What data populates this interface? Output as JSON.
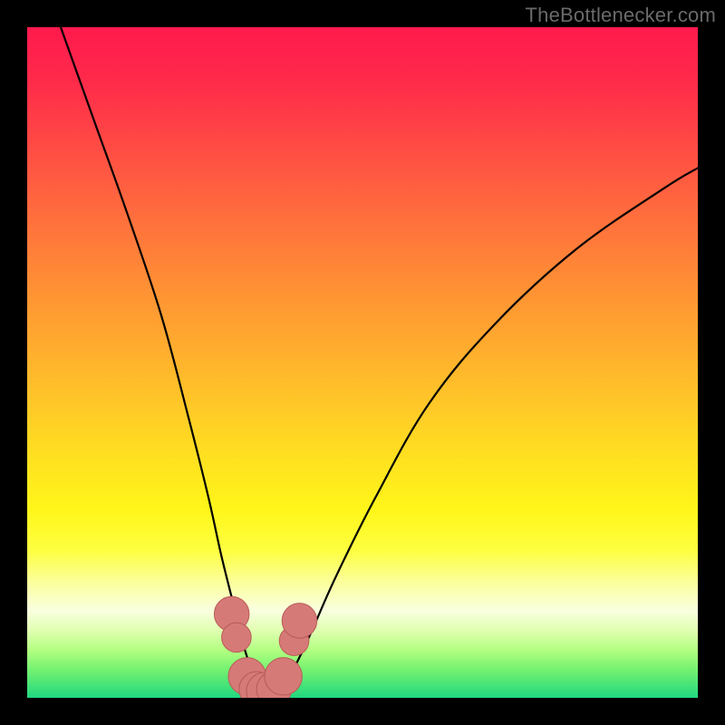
{
  "watermark": "TheBottlenecker.com",
  "colors": {
    "frame": "#000000",
    "gradient_top": "#ff1a4d",
    "gradient_bottom": "#20d880",
    "curve_stroke": "#000000",
    "marker_fill": "#d67a78",
    "marker_stroke": "#b85a56"
  },
  "chart_data": {
    "type": "line",
    "title": "",
    "xlabel": "",
    "ylabel": "",
    "xlim": [
      0,
      100
    ],
    "ylim": [
      0,
      100
    ],
    "series": [
      {
        "name": "curve",
        "x": [
          5,
          10,
          15,
          20,
          24,
          27,
          29,
          31,
          32.5,
          34,
          35.5,
          37,
          39,
          42,
          46,
          52,
          60,
          70,
          82,
          95,
          100
        ],
        "y": [
          100,
          86,
          72,
          57,
          42,
          30,
          21,
          13,
          7,
          3,
          1,
          1,
          3,
          9,
          18,
          30,
          44,
          56,
          67,
          76,
          79
        ]
      }
    ],
    "markers": {
      "name": "highlight-points",
      "x": [
        30.5,
        31.2,
        32.8,
        34.2,
        35.5,
        36.8,
        38.2,
        39.8,
        40.6
      ],
      "y": [
        12.5,
        9.0,
        3.2,
        1.3,
        1.0,
        1.3,
        3.2,
        8.5,
        11.5
      ],
      "r": [
        2.6,
        2.2,
        2.8,
        2.6,
        2.8,
        2.6,
        2.8,
        2.2,
        2.6
      ]
    }
  }
}
